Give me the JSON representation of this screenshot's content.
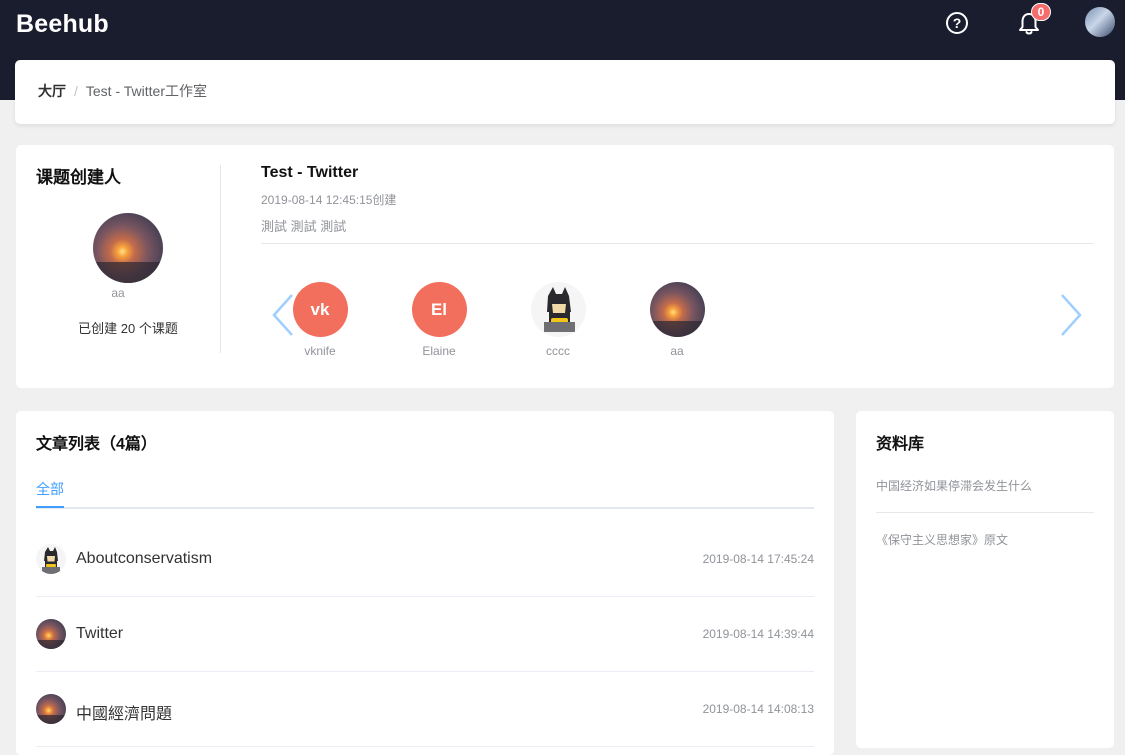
{
  "header": {
    "logo": "Beehub",
    "help_icon": "question-circle-icon",
    "bell_icon": "bell-icon",
    "notification_count": "0"
  },
  "breadcrumb": {
    "home": "大厅",
    "separator": "/",
    "current": "Test - Twitter工作室"
  },
  "creator": {
    "title": "课题创建人",
    "name": "aa",
    "count_text": "已创建 20 个课题"
  },
  "topic": {
    "title": "Test - Twitter",
    "date": "2019-08-14 12:45:15创建",
    "description": "測試 測試 測試"
  },
  "members": [
    {
      "initials": "vk",
      "name": "vknife",
      "color": "#f26f5e"
    },
    {
      "initials": "El",
      "name": "Elaine",
      "color": "#f26f5e"
    },
    {
      "initials": "",
      "name": "cccc",
      "avatar": "batman-icon"
    },
    {
      "initials": "",
      "name": "aa",
      "avatar": "sunset-photo"
    }
  ],
  "articles": {
    "title": "文章列表（4篇）",
    "tab_all": "全部",
    "items": [
      {
        "title": "Aboutconservatism",
        "time": "2019-08-14 17:45:24",
        "avatar": "batman-icon"
      },
      {
        "title": "Twitter",
        "time": "2019-08-14 14:39:44",
        "avatar": "sunset-photo"
      },
      {
        "title": "中國經濟問題",
        "time": "2019-08-14 14:08:13",
        "avatar": "sunset-photo"
      }
    ]
  },
  "library": {
    "title": "资料库",
    "items": [
      "中国经济如果停滞会发生什么",
      "《保守主义思想家》原文"
    ]
  },
  "colors": {
    "header_bg": "#1a1d2e",
    "accent": "#409eff",
    "badge": "#f56c6c",
    "avatar_coral": "#f26f5e"
  }
}
